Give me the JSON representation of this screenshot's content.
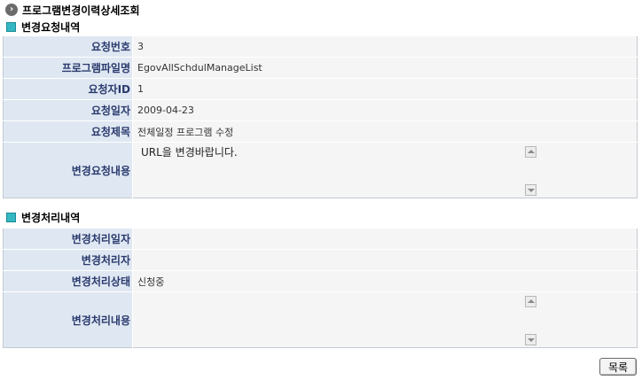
{
  "page": {
    "title": "프로그램변경이력상세조회"
  },
  "request_section": {
    "title": "변경요청내역",
    "rows": [
      {
        "label": "요청번호",
        "value": "3"
      },
      {
        "label": "프로그램파일명",
        "value": "EgovAllSchdulManageList"
      },
      {
        "label": "요청자ID",
        "value": "1"
      },
      {
        "label": "요청일자",
        "value": "2009-04-23"
      },
      {
        "label": "요청제목",
        "value": "전체일정 프로그램 수정"
      }
    ],
    "content_label": "변경요청내용",
    "content_value": "URL을 변경바랍니다."
  },
  "process_section": {
    "title": "변경처리내역",
    "rows": [
      {
        "label": "변경처리일자",
        "value": ""
      },
      {
        "label": "변경처리자",
        "value": ""
      },
      {
        "label": "변경처리상태",
        "value": "신청중"
      }
    ],
    "content_label": "변경처리내용",
    "content_value": ""
  },
  "buttons": {
    "list_label": "목록"
  },
  "colors": {
    "label_bg": "#dfe8f2",
    "label_text": "#2a3a6e",
    "icon_teal": "#35b8c4"
  },
  "icons": {
    "title": "chevron-right-circle-icon",
    "section": "square-bullet-icon"
  }
}
